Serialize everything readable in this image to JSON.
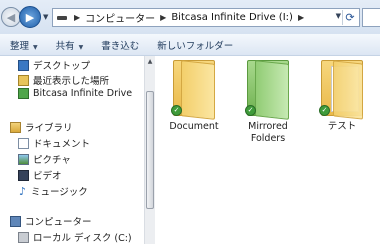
{
  "address_bar": {
    "segments": [
      "コンピューター",
      "Bitcasa Infinite Drive (I:)"
    ],
    "back_icon": "back-arrow",
    "forward_icon": "forward-arrow",
    "refresh_icon": "refresh"
  },
  "command_bar": {
    "organize": "整理",
    "share": "共有",
    "burn": "書き込む",
    "new_folder": "新しいフォルダー"
  },
  "nav_pane": {
    "favorites": [
      "デスクトップ",
      "最近表示した場所",
      "Bitcasa Infinite Drive"
    ],
    "libraries_header": "ライブラリ",
    "libraries": [
      "ドキュメント",
      "ピクチャ",
      "ビデオ",
      "ミュージック"
    ],
    "computer_header": "コンピューター",
    "computer": [
      "ローカル ディスク (C:)"
    ]
  },
  "content": {
    "folders": [
      {
        "name": "Document",
        "color": "#e9b94a"
      },
      {
        "name": "Mirrored Folders",
        "color": "#6fb150"
      },
      {
        "name": "テスト",
        "color": "#e9b94a"
      }
    ],
    "sync_status_color": "#3f9b3a"
  }
}
